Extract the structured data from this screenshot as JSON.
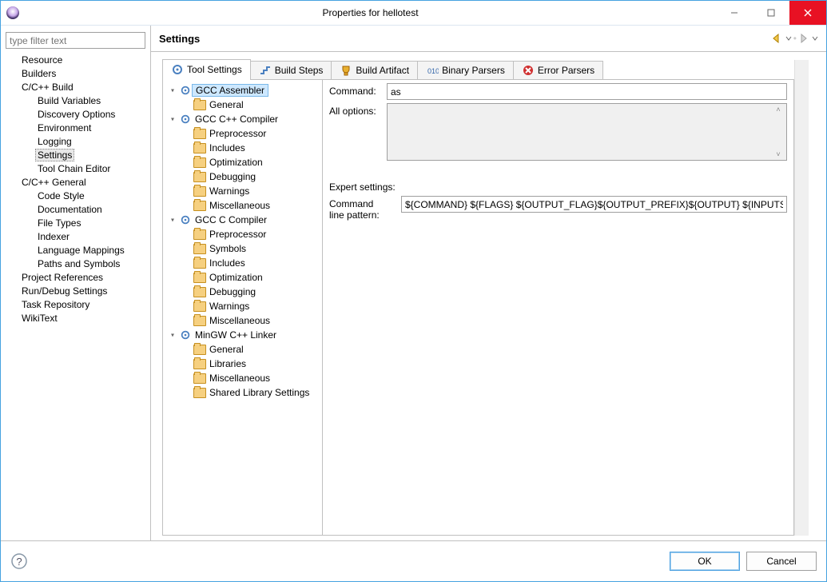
{
  "window": {
    "title": "Properties for hellotest"
  },
  "filter_placeholder": "type filter text",
  "nav": [
    {
      "label": "Resource",
      "lvl": 1
    },
    {
      "label": "Builders",
      "lvl": 1
    },
    {
      "label": "C/C++ Build",
      "lvl": 1
    },
    {
      "label": "Build Variables",
      "lvl": 2
    },
    {
      "label": "Discovery Options",
      "lvl": 2
    },
    {
      "label": "Environment",
      "lvl": 2
    },
    {
      "label": "Logging",
      "lvl": 2
    },
    {
      "label": "Settings",
      "lvl": 2,
      "sel": true
    },
    {
      "label": "Tool Chain Editor",
      "lvl": 2
    },
    {
      "label": "C/C++ General",
      "lvl": 1
    },
    {
      "label": "Code Style",
      "lvl": 2
    },
    {
      "label": "Documentation",
      "lvl": 2
    },
    {
      "label": "File Types",
      "lvl": 2
    },
    {
      "label": "Indexer",
      "lvl": 2
    },
    {
      "label": "Language Mappings",
      "lvl": 2
    },
    {
      "label": "Paths and Symbols",
      "lvl": 2
    },
    {
      "label": "Project References",
      "lvl": 1
    },
    {
      "label": "Run/Debug Settings",
      "lvl": 1
    },
    {
      "label": "Task Repository",
      "lvl": 1
    },
    {
      "label": "WikiText",
      "lvl": 1
    }
  ],
  "header_title": "Settings",
  "tabs": {
    "tool_settings": "Tool Settings",
    "build_steps": "Build Steps",
    "build_artifact": "Build Artifact",
    "binary_parsers": "Binary Parsers",
    "error_parsers": "Error Parsers"
  },
  "tool_tree": [
    {
      "d": 0,
      "exp": "▾",
      "ico": "gear",
      "label": "GCC Assembler",
      "sel": true
    },
    {
      "d": 1,
      "exp": "",
      "ico": "folder",
      "label": "General"
    },
    {
      "d": 0,
      "exp": "▾",
      "ico": "gear",
      "label": "GCC C++ Compiler"
    },
    {
      "d": 1,
      "exp": "",
      "ico": "folder",
      "label": "Preprocessor"
    },
    {
      "d": 1,
      "exp": "",
      "ico": "folder",
      "label": "Includes"
    },
    {
      "d": 1,
      "exp": "",
      "ico": "folder",
      "label": "Optimization"
    },
    {
      "d": 1,
      "exp": "",
      "ico": "folder",
      "label": "Debugging"
    },
    {
      "d": 1,
      "exp": "",
      "ico": "folder",
      "label": "Warnings"
    },
    {
      "d": 1,
      "exp": "",
      "ico": "folder",
      "label": "Miscellaneous"
    },
    {
      "d": 0,
      "exp": "▾",
      "ico": "gear",
      "label": "GCC C Compiler"
    },
    {
      "d": 1,
      "exp": "",
      "ico": "folder",
      "label": "Preprocessor"
    },
    {
      "d": 1,
      "exp": "",
      "ico": "folder",
      "label": "Symbols"
    },
    {
      "d": 1,
      "exp": "",
      "ico": "folder",
      "label": "Includes"
    },
    {
      "d": 1,
      "exp": "",
      "ico": "folder",
      "label": "Optimization"
    },
    {
      "d": 1,
      "exp": "",
      "ico": "folder",
      "label": "Debugging"
    },
    {
      "d": 1,
      "exp": "",
      "ico": "folder",
      "label": "Warnings"
    },
    {
      "d": 1,
      "exp": "",
      "ico": "folder",
      "label": "Miscellaneous"
    },
    {
      "d": 0,
      "exp": "▾",
      "ico": "gear",
      "label": "MinGW C++ Linker"
    },
    {
      "d": 1,
      "exp": "",
      "ico": "folder",
      "label": "General"
    },
    {
      "d": 1,
      "exp": "",
      "ico": "folder",
      "label": "Libraries"
    },
    {
      "d": 1,
      "exp": "",
      "ico": "folder",
      "label": "Miscellaneous"
    },
    {
      "d": 1,
      "exp": "",
      "ico": "folder",
      "label": "Shared Library Settings"
    }
  ],
  "form": {
    "command_label": "Command:",
    "command_value": "as",
    "all_options_label": "All options:",
    "all_options_value": "",
    "expert_label": "Expert settings:",
    "pattern_label": "Command\nline pattern:",
    "pattern_value": "${COMMAND} ${FLAGS} ${OUTPUT_FLAG}${OUTPUT_PREFIX}${OUTPUT} ${INPUTS}"
  },
  "buttons": {
    "ok": "OK",
    "cancel": "Cancel"
  }
}
